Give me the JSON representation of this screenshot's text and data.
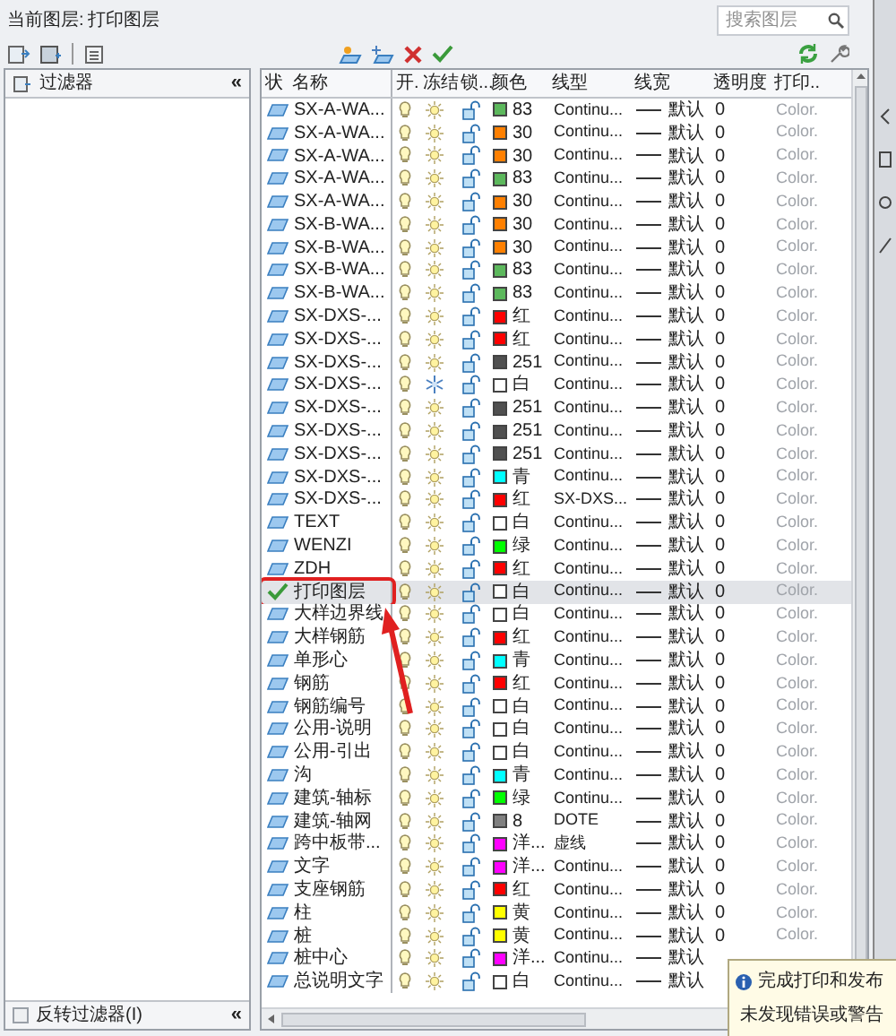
{
  "current_layer": {
    "label": "当前图层:",
    "value": "打印图层"
  },
  "search": {
    "placeholder": "搜索图层"
  },
  "filter_panel": {
    "title": "过滤器",
    "collapse": "«",
    "invert_filter": {
      "label": "反转过滤器(I)",
      "checked": false
    },
    "collapse_bottom": "«"
  },
  "table": {
    "columns": [
      "状",
      "名称",
      "开.",
      "冻结",
      "锁...",
      "颜色",
      "线型",
      "线宽",
      "透明度",
      "打印.."
    ],
    "rows": [
      {
        "name": "SX-A-WA...",
        "current": false,
        "selected": false,
        "frozen": false,
        "color": "#5cb85c",
        "color_name": "83",
        "linetype": "Continu...",
        "lineweight": "默认",
        "transparency": "0",
        "plot_style": "Color."
      },
      {
        "name": "SX-A-WA...",
        "current": false,
        "selected": false,
        "frozen": false,
        "color": "#ff8000",
        "color_name": "30",
        "linetype": "Continu...",
        "lineweight": "默认",
        "transparency": "0",
        "plot_style": "Color."
      },
      {
        "name": "SX-A-WA...",
        "current": false,
        "selected": false,
        "frozen": false,
        "color": "#ff8000",
        "color_name": "30",
        "linetype": "Continu...",
        "lineweight": "默认",
        "transparency": "0",
        "plot_style": "Color."
      },
      {
        "name": "SX-A-WA...",
        "current": false,
        "selected": false,
        "frozen": false,
        "color": "#5cb85c",
        "color_name": "83",
        "linetype": "Continu...",
        "lineweight": "默认",
        "transparency": "0",
        "plot_style": "Color."
      },
      {
        "name": "SX-A-WA...",
        "current": false,
        "selected": false,
        "frozen": false,
        "color": "#ff8000",
        "color_name": "30",
        "linetype": "Continu...",
        "lineweight": "默认",
        "transparency": "0",
        "plot_style": "Color."
      },
      {
        "name": "SX-B-WA...",
        "current": false,
        "selected": false,
        "frozen": false,
        "color": "#ff8000",
        "color_name": "30",
        "linetype": "Continu...",
        "lineweight": "默认",
        "transparency": "0",
        "plot_style": "Color."
      },
      {
        "name": "SX-B-WA...",
        "current": false,
        "selected": false,
        "frozen": false,
        "color": "#ff8000",
        "color_name": "30",
        "linetype": "Continu...",
        "lineweight": "默认",
        "transparency": "0",
        "plot_style": "Color."
      },
      {
        "name": "SX-B-WA...",
        "current": false,
        "selected": false,
        "frozen": false,
        "color": "#5cb85c",
        "color_name": "83",
        "linetype": "Continu...",
        "lineweight": "默认",
        "transparency": "0",
        "plot_style": "Color."
      },
      {
        "name": "SX-B-WA...",
        "current": false,
        "selected": false,
        "frozen": false,
        "color": "#5cb85c",
        "color_name": "83",
        "linetype": "Continu...",
        "lineweight": "默认",
        "transparency": "0",
        "plot_style": "Color."
      },
      {
        "name": "SX-DXS-...",
        "current": false,
        "selected": false,
        "frozen": false,
        "color": "#ff0000",
        "color_name": "红",
        "linetype": "Continu...",
        "lineweight": "默认",
        "transparency": "0",
        "plot_style": "Color."
      },
      {
        "name": "SX-DXS-...",
        "current": false,
        "selected": false,
        "frozen": false,
        "color": "#ff0000",
        "color_name": "红",
        "linetype": "Continu...",
        "lineweight": "默认",
        "transparency": "0",
        "plot_style": "Color."
      },
      {
        "name": "SX-DXS-...",
        "current": false,
        "selected": false,
        "frozen": false,
        "color": "#505050",
        "color_name": "251",
        "linetype": "Continu...",
        "lineweight": "默认",
        "transparency": "0",
        "plot_style": "Color."
      },
      {
        "name": "SX-DXS-...",
        "current": false,
        "selected": false,
        "frozen": true,
        "color": "#ffffff",
        "color_name": "白",
        "linetype": "Continu...",
        "lineweight": "默认",
        "transparency": "0",
        "plot_style": "Color."
      },
      {
        "name": "SX-DXS-...",
        "current": false,
        "selected": false,
        "frozen": false,
        "color": "#505050",
        "color_name": "251",
        "linetype": "Continu...",
        "lineweight": "默认",
        "transparency": "0",
        "plot_style": "Color."
      },
      {
        "name": "SX-DXS-...",
        "current": false,
        "selected": false,
        "frozen": false,
        "color": "#505050",
        "color_name": "251",
        "linetype": "Continu...",
        "lineweight": "默认",
        "transparency": "0",
        "plot_style": "Color."
      },
      {
        "name": "SX-DXS-...",
        "current": false,
        "selected": false,
        "frozen": false,
        "color": "#505050",
        "color_name": "251",
        "linetype": "Continu...",
        "lineweight": "默认",
        "transparency": "0",
        "plot_style": "Color."
      },
      {
        "name": "SX-DXS-...",
        "current": false,
        "selected": false,
        "frozen": false,
        "color": "#00ffff",
        "color_name": "青",
        "linetype": "Continu...",
        "lineweight": "默认",
        "transparency": "0",
        "plot_style": "Color."
      },
      {
        "name": "SX-DXS-...",
        "current": false,
        "selected": false,
        "frozen": false,
        "color": "#ff0000",
        "color_name": "红",
        "linetype": "SX-DXS...",
        "lineweight": "默认",
        "transparency": "0",
        "plot_style": "Color."
      },
      {
        "name": "TEXT",
        "current": false,
        "selected": false,
        "frozen": false,
        "color": "#ffffff",
        "color_name": "白",
        "linetype": "Continu...",
        "lineweight": "默认",
        "transparency": "0",
        "plot_style": "Color."
      },
      {
        "name": "WENZI",
        "current": false,
        "selected": false,
        "frozen": false,
        "color": "#00ff00",
        "color_name": "绿",
        "linetype": "Continu...",
        "lineweight": "默认",
        "transparency": "0",
        "plot_style": "Color."
      },
      {
        "name": "ZDH",
        "current": false,
        "selected": false,
        "frozen": false,
        "color": "#ff0000",
        "color_name": "红",
        "linetype": "Continu...",
        "lineweight": "默认",
        "transparency": "0",
        "plot_style": "Color."
      },
      {
        "name": "打印图层",
        "current": true,
        "selected": true,
        "frozen": false,
        "color": "#ffffff",
        "color_name": "白",
        "linetype": "Continu...",
        "lineweight": "默认",
        "transparency": "0",
        "plot_style": "Color."
      },
      {
        "name": "大样边界线",
        "current": false,
        "selected": false,
        "frozen": false,
        "color": "#ffffff",
        "color_name": "白",
        "linetype": "Continu...",
        "lineweight": "默认",
        "transparency": "0",
        "plot_style": "Color."
      },
      {
        "name": "大样钢筋",
        "current": false,
        "selected": false,
        "frozen": false,
        "color": "#ff0000",
        "color_name": "红",
        "linetype": "Continu...",
        "lineweight": "默认",
        "transparency": "0",
        "plot_style": "Color."
      },
      {
        "name": "单形心",
        "current": false,
        "selected": false,
        "frozen": false,
        "color": "#00ffff",
        "color_name": "青",
        "linetype": "Continu...",
        "lineweight": "默认",
        "transparency": "0",
        "plot_style": "Color."
      },
      {
        "name": "钢筋",
        "current": false,
        "selected": false,
        "frozen": false,
        "color": "#ff0000",
        "color_name": "红",
        "linetype": "Continu...",
        "lineweight": "默认",
        "transparency": "0",
        "plot_style": "Color."
      },
      {
        "name": "钢筋编号",
        "current": false,
        "selected": false,
        "frozen": false,
        "color": "#ffffff",
        "color_name": "白",
        "linetype": "Continu...",
        "lineweight": "默认",
        "transparency": "0",
        "plot_style": "Color."
      },
      {
        "name": "公用-说明",
        "current": false,
        "selected": false,
        "frozen": false,
        "color": "#ffffff",
        "color_name": "白",
        "linetype": "Continu...",
        "lineweight": "默认",
        "transparency": "0",
        "plot_style": "Color."
      },
      {
        "name": "公用-引出",
        "current": false,
        "selected": false,
        "frozen": false,
        "color": "#ffffff",
        "color_name": "白",
        "linetype": "Continu...",
        "lineweight": "默认",
        "transparency": "0",
        "plot_style": "Color."
      },
      {
        "name": "沟",
        "current": false,
        "selected": false,
        "frozen": false,
        "color": "#00ffff",
        "color_name": "青",
        "linetype": "Continu...",
        "lineweight": "默认",
        "transparency": "0",
        "plot_style": "Color."
      },
      {
        "name": "建筑-轴标",
        "current": false,
        "selected": false,
        "frozen": false,
        "color": "#00ff00",
        "color_name": "绿",
        "linetype": "Continu...",
        "lineweight": "默认",
        "transparency": "0",
        "plot_style": "Color."
      },
      {
        "name": "建筑-轴网",
        "current": false,
        "selected": false,
        "frozen": false,
        "color": "#808080",
        "color_name": "8",
        "linetype": "DOTE",
        "lineweight": "默认",
        "transparency": "0",
        "plot_style": "Color."
      },
      {
        "name": "跨中板带...",
        "current": false,
        "selected": false,
        "frozen": false,
        "color": "#ff00ff",
        "color_name": "洋...",
        "linetype": "虚线",
        "lineweight": "默认",
        "transparency": "0",
        "plot_style": "Color."
      },
      {
        "name": "文字",
        "current": false,
        "selected": false,
        "frozen": false,
        "color": "#ff00ff",
        "color_name": "洋...",
        "linetype": "Continu...",
        "lineweight": "默认",
        "transparency": "0",
        "plot_style": "Color."
      },
      {
        "name": "支座钢筋",
        "current": false,
        "selected": false,
        "frozen": false,
        "color": "#ff0000",
        "color_name": "红",
        "linetype": "Continu...",
        "lineweight": "默认",
        "transparency": "0",
        "plot_style": "Color."
      },
      {
        "name": "柱",
        "current": false,
        "selected": false,
        "frozen": false,
        "color": "#ffff00",
        "color_name": "黄",
        "linetype": "Continu...",
        "lineweight": "默认",
        "transparency": "0",
        "plot_style": "Color."
      },
      {
        "name": "桩",
        "current": false,
        "selected": false,
        "frozen": false,
        "color": "#ffff00",
        "color_name": "黄",
        "linetype": "Continu...",
        "lineweight": "默认",
        "transparency": "0",
        "plot_style": "Color."
      },
      {
        "name": "桩中心",
        "current": false,
        "selected": false,
        "frozen": false,
        "color": "#ff00ff",
        "color_name": "洋...",
        "linetype": "Continu...",
        "lineweight": "默认"
      },
      {
        "name": "总说明文字",
        "current": false,
        "selected": false,
        "frozen": false,
        "color": "#ffffff",
        "color_name": "白",
        "linetype": "Continu...",
        "lineweight": "默认"
      }
    ]
  },
  "notification": {
    "title": "完成打印和发布",
    "message": "未发现错误或警告"
  }
}
